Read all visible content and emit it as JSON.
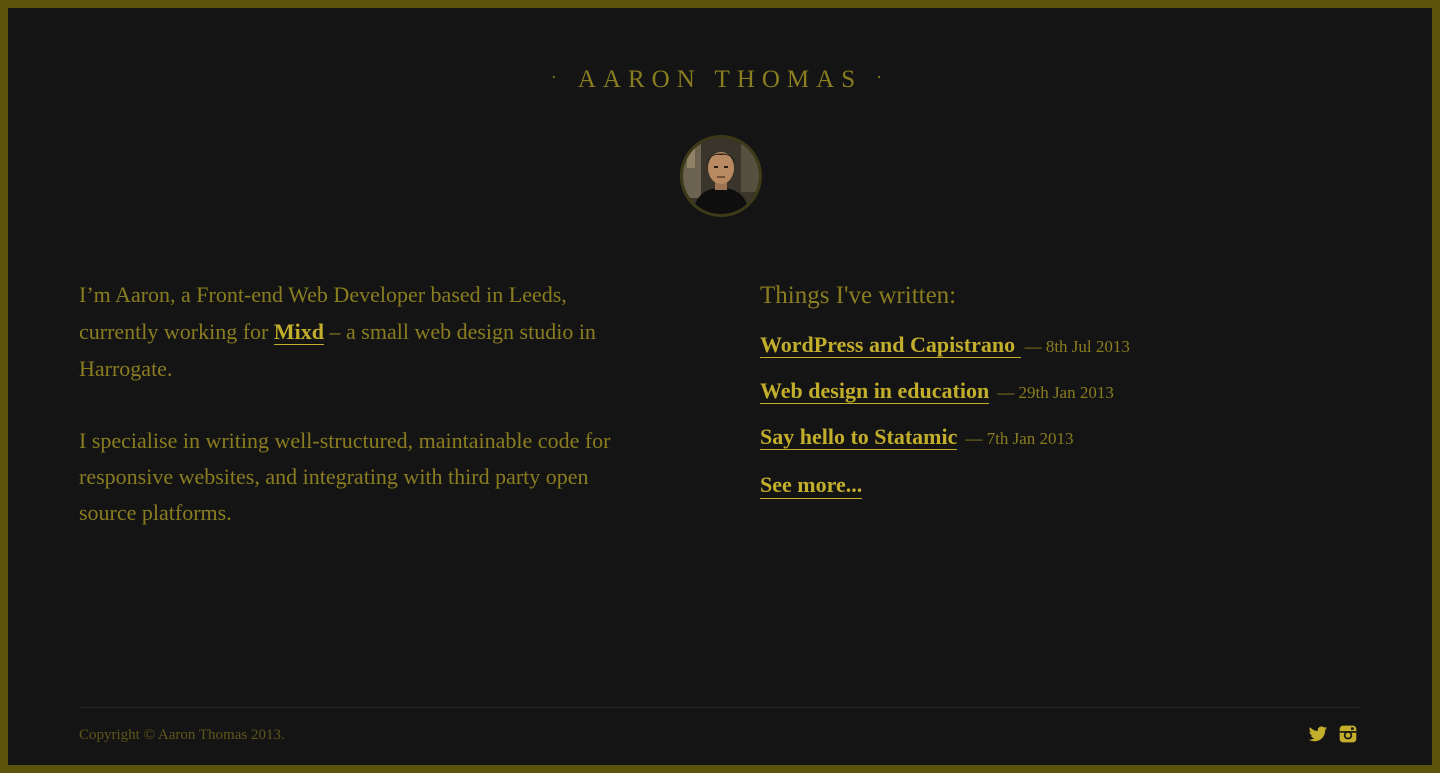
{
  "header": {
    "dot_left": "·",
    "title": "AARON THOMAS",
    "dot_right": "·"
  },
  "avatar": {
    "alt": "Aaron Thomas"
  },
  "bio": {
    "p1_before": "I’m Aaron, a Front-end Web Developer based in Leeds, currently working for ",
    "p1_link": "Mixd",
    "p1_after": " – a small web design studio in Harrogate.",
    "p2": "I specialise in writing well-structured, maintainable code for responsive websites, and integrating with third party open source platforms."
  },
  "writing": {
    "heading": "Things I've written:",
    "posts": [
      {
        "title": "WordPress and Capistrano ",
        "date": "— 8th Jul 2013"
      },
      {
        "title": "Web design in education",
        "date": "— 29th Jan 2013"
      },
      {
        "title": "Say hello to Statamic",
        "date": "— 7th Jan 2013"
      }
    ],
    "see_more": "See more... "
  },
  "footer": {
    "copyright": "Copyright © Aaron Thomas 2013.",
    "icons": [
      "twitter-icon",
      "instagram-icon"
    ]
  },
  "colors": {
    "page_border": "#5b540a",
    "background": "#141414",
    "text": "#8a7d20",
    "link": "#c2ae2b"
  }
}
